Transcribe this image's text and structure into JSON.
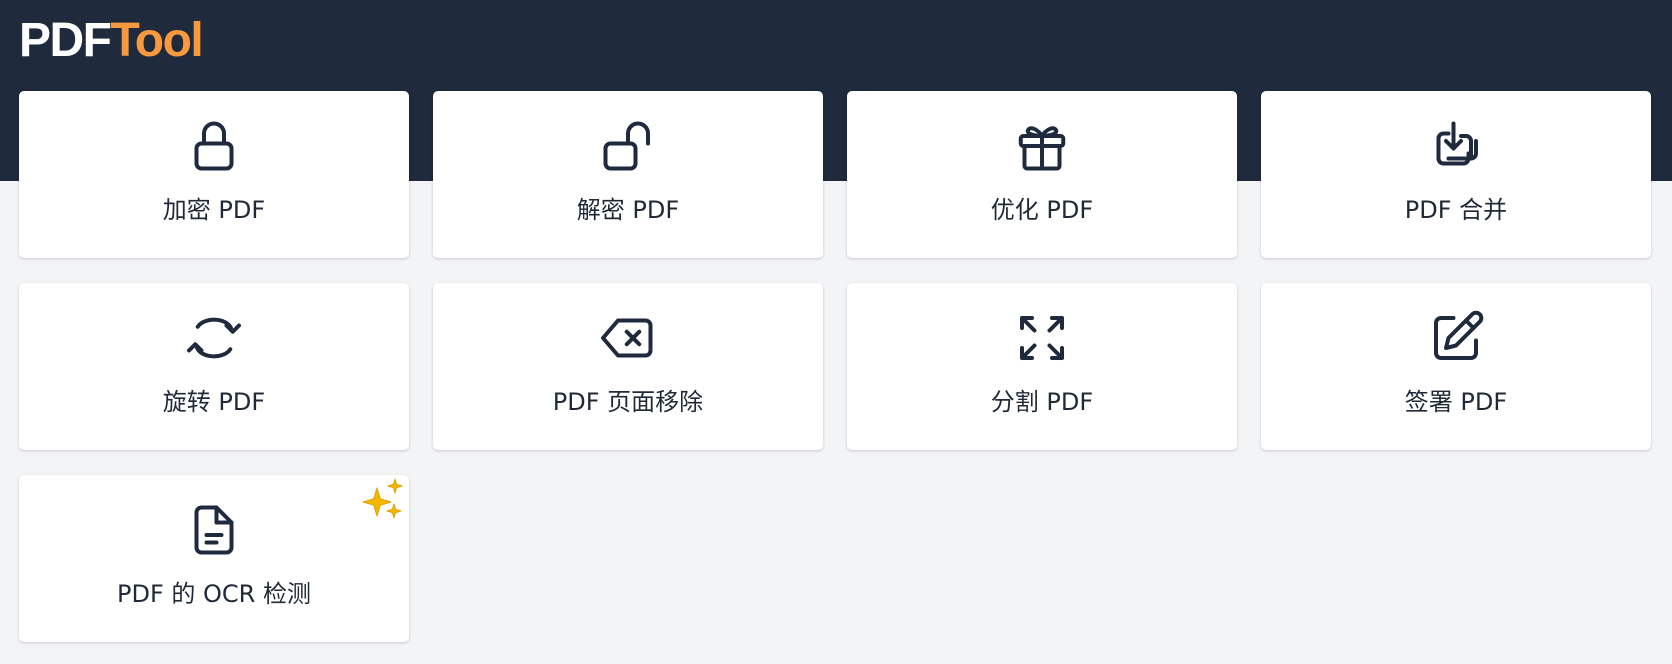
{
  "brand": {
    "part1": "PDF",
    "part2": "Tool"
  },
  "colors": {
    "header_bg": "#1f2a3c",
    "accent": "#f6993f",
    "sparkle": "#f5b800"
  },
  "tools": [
    {
      "label": "加密 PDF",
      "icon": "lock-icon"
    },
    {
      "label": "解密 PDF",
      "icon": "unlock-icon"
    },
    {
      "label": "优化 PDF",
      "icon": "gift-icon"
    },
    {
      "label": "PDF 合并",
      "icon": "merge-icon"
    },
    {
      "label": "旋转 PDF",
      "icon": "rotate-icon"
    },
    {
      "label": "PDF 页面移除",
      "icon": "backspace-icon"
    },
    {
      "label": "分割 PDF",
      "icon": "expand-arrows-icon"
    },
    {
      "label": "签署 PDF",
      "icon": "edit-icon"
    },
    {
      "label": "PDF 的 OCR 检测",
      "icon": "document-icon",
      "badge": "sparkles-icon"
    }
  ]
}
